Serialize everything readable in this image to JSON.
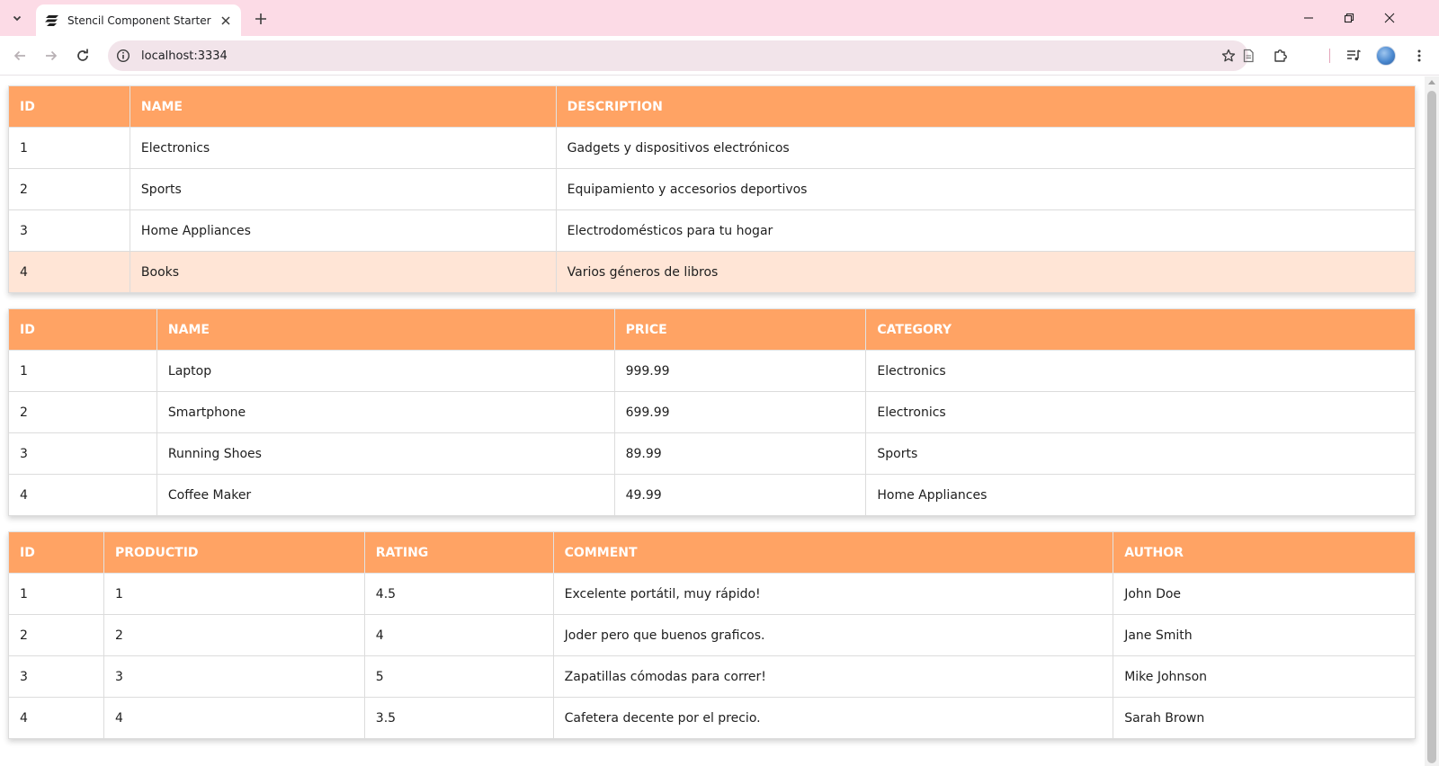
{
  "browser": {
    "tab_title": "Stencil Component Starter",
    "url": "localhost:3334"
  },
  "tables": {
    "categories": {
      "headers": [
        "ID",
        "NAME",
        "DESCRIPTION"
      ],
      "rows": [
        [
          "1",
          "Electronics",
          "Gadgets y dispositivos electrónicos"
        ],
        [
          "2",
          "Sports",
          "Equipamiento y accesorios deportivos"
        ],
        [
          "3",
          "Home Appliances",
          "Electrodomésticos para tu hogar"
        ],
        [
          "4",
          "Books",
          "Varios géneros de libros"
        ]
      ],
      "highlighted_row": 4
    },
    "products": {
      "headers": [
        "ID",
        "NAME",
        "PRICE",
        "CATEGORY"
      ],
      "rows": [
        [
          "1",
          "Laptop",
          "999.99",
          "Electronics"
        ],
        [
          "2",
          "Smartphone",
          "699.99",
          "Electronics"
        ],
        [
          "3",
          "Running Shoes",
          "89.99",
          "Sports"
        ],
        [
          "4",
          "Coffee Maker",
          "49.99",
          "Home Appliances"
        ]
      ]
    },
    "reviews": {
      "headers": [
        "ID",
        "PRODUCTID",
        "RATING",
        "COMMENT",
        "AUTHOR"
      ],
      "rows": [
        [
          "1",
          "1",
          "4.5",
          "Excelente portátil, muy rápido!",
          "John Doe"
        ],
        [
          "2",
          "2",
          "4",
          "Joder pero que buenos graficos.",
          "Jane Smith"
        ],
        [
          "3",
          "3",
          "5",
          "Zapatillas cómodas para correr!",
          "Mike Johnson"
        ],
        [
          "4",
          "4",
          "3.5",
          "Cafetera decente por el precio.",
          "Sarah Brown"
        ]
      ]
    }
  },
  "colors": {
    "header_bg": "#ffa364",
    "highlight_row_bg": "#ffe5d6",
    "tabstrip_bg": "#fcdbe6"
  }
}
